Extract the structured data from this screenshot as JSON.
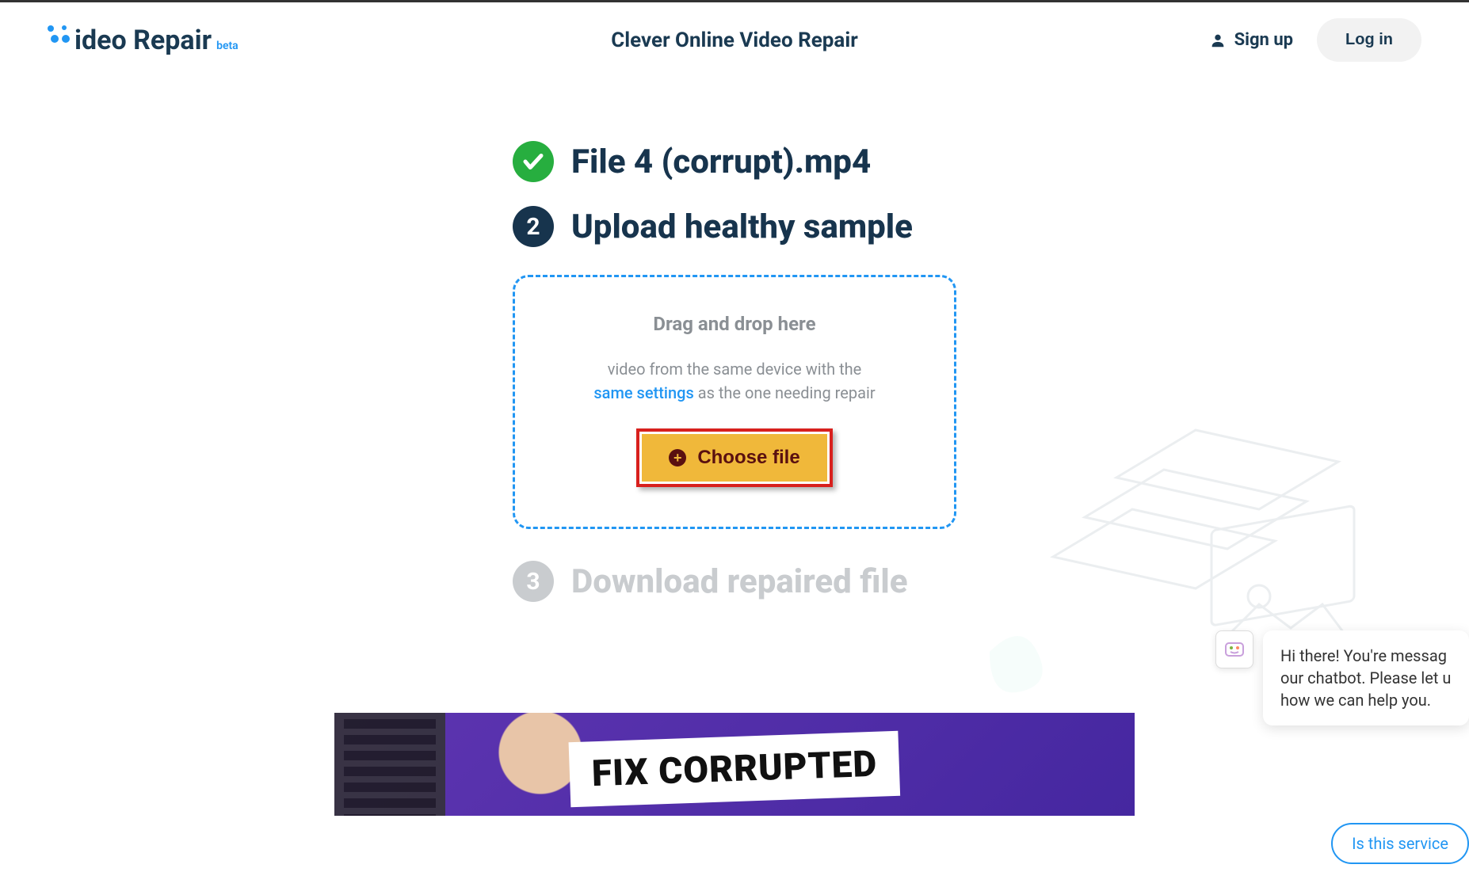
{
  "header": {
    "logo_text": "ideo Repair",
    "logo_badge": "beta",
    "title": "Clever Online Video Repair",
    "signup": "Sign up",
    "login": "Log in"
  },
  "steps": {
    "step1": {
      "filename": "File 4 (corrupt).mp4"
    },
    "step2": {
      "number": "2",
      "title": "Upload healthy sample"
    },
    "step3": {
      "number": "3",
      "title": "Download repaired file"
    }
  },
  "dropzone": {
    "title": "Drag and drop here",
    "desc_pre": "video from the same device with the",
    "desc_link": "same settings",
    "desc_post": " as the one needing repair",
    "button": "Choose file"
  },
  "banner": {
    "text": "FIX CORRUPTED"
  },
  "chat": {
    "message": "Hi there! You're messag our chatbot. Please let u how we can help you.",
    "suggestion": "Is this service"
  }
}
